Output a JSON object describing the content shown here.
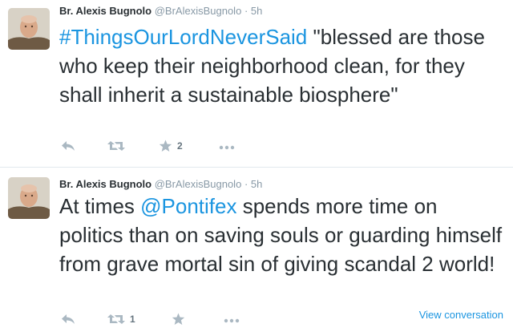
{
  "tweets": [
    {
      "author_name": "Br. Alexis Bugnolo",
      "handle": "@BrAlexisBugnolo",
      "separator": "·",
      "time": "5h",
      "text_parts": [
        {
          "text": "#ThingsOurLordNeverSaid",
          "link": true
        },
        {
          "text": " \"blessed are those who keep their neighborhood clean, for they shall inherit a sustainable biosphere\"",
          "link": false
        }
      ],
      "actions": {
        "reply_icon": "reply-icon",
        "retweet_icon": "retweet-icon",
        "retweet_count": "",
        "favorite_icon": "star-icon",
        "favorite_count": "2",
        "more_icon": "more-icon"
      }
    },
    {
      "author_name": "Br. Alexis Bugnolo",
      "handle": "@BrAlexisBugnolo",
      "separator": "·",
      "time": "5h",
      "text_parts": [
        {
          "text": "At times ",
          "link": false
        },
        {
          "text": "@Pontifex",
          "link": true
        },
        {
          "text": " spends more time on politics than on saving souls or guarding himself from grave mortal sin of giving scandal 2  world!",
          "link": false
        }
      ],
      "view_conversation": "View conversation",
      "actions": {
        "reply_icon": "reply-icon",
        "retweet_icon": "retweet-icon",
        "retweet_count": "1",
        "favorite_icon": "star-icon",
        "favorite_count": "",
        "more_icon": "more-icon"
      }
    }
  ],
  "colors": {
    "link": "#1b95e0",
    "text": "#292f33",
    "meta": "#8899a6",
    "divider": "#e1e8ed"
  }
}
